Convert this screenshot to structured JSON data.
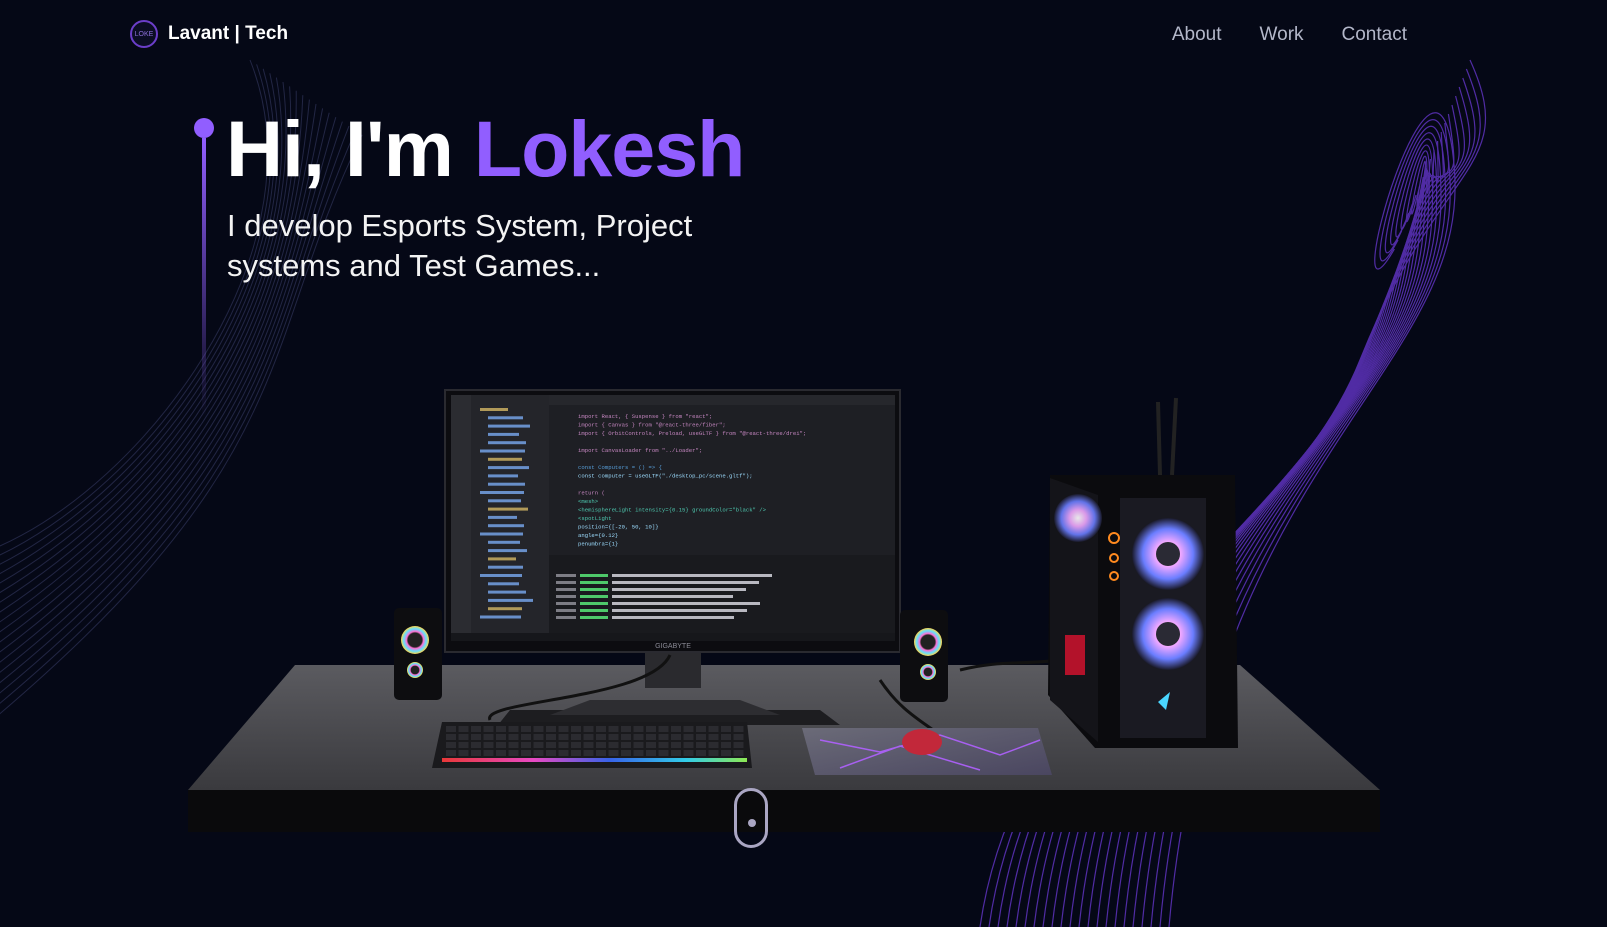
{
  "brand": {
    "name": "Lavant | Tech",
    "mark": "LOKE"
  },
  "nav": {
    "links": [
      "About",
      "Work",
      "Contact"
    ]
  },
  "hero": {
    "greeting": "Hi, I'm",
    "name": "Lokesh",
    "subtitle": "I develop Esports System, Project systems and Test Games..."
  },
  "scene": {
    "monitor_brand": "GIGABYTE",
    "code_lines": [
      "import React, { Suspense } from \"react\";",
      "import { Canvas } from \"@react-three/fiber\";",
      "import { OrbitControls, Preload, useGLTF } from \"@react-three/drei\";",
      "",
      "import CanvasLoader from \"../Loader\";",
      "",
      "const Computers = () => {",
      "  const computer = useGLTF(\"./desktop_pc/scene.gltf\");",
      "",
      "  return (",
      "    <mesh>",
      "      <hemisphereLight intensity={0.15} groundColor=\"black\" />",
      "      <spotLight",
      "        position={[-20, 50, 10]}",
      "        angle={0.12}",
      "        penumbra={1}"
    ]
  },
  "colors": {
    "background": "#050816",
    "accent": "#915eff",
    "nav_text": "#b3b7c9"
  }
}
